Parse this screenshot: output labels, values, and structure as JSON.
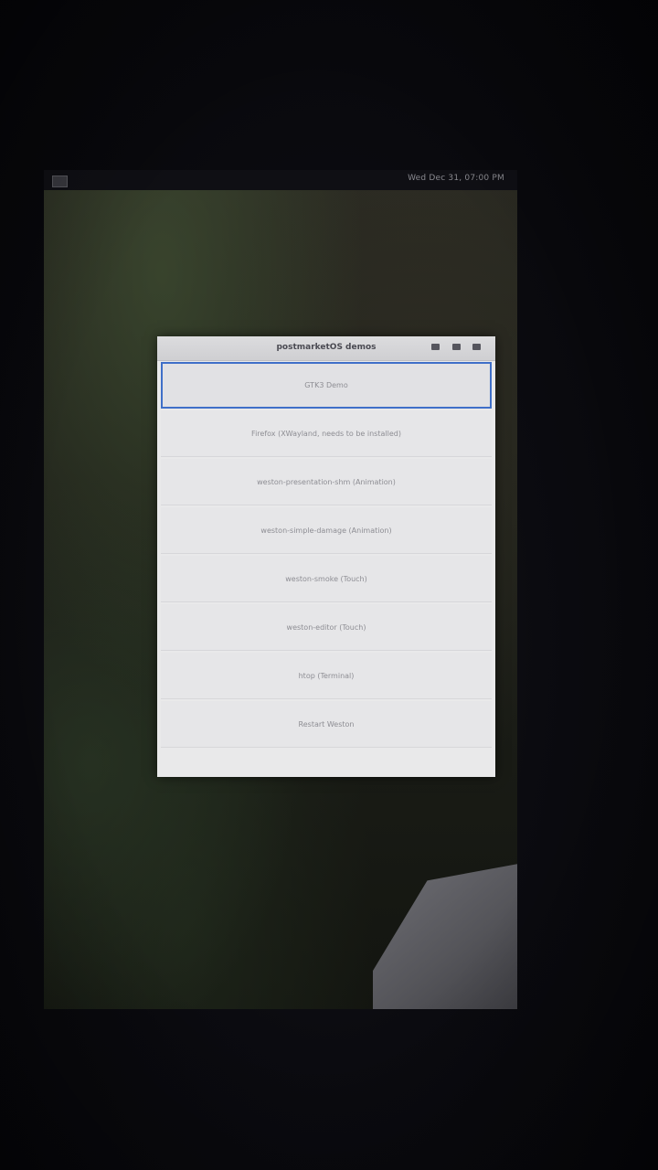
{
  "topbar": {
    "launcher_icon": "app-launcher-icon",
    "clock": "Wed Dec 31, 07:00 PM"
  },
  "window": {
    "title": "postmarketOS demos",
    "controls": [
      "minimize-icon",
      "maximize-icon",
      "close-icon"
    ],
    "items": [
      {
        "label": "GTK3 Demo",
        "selected": true
      },
      {
        "label": "Firefox (XWayland, needs to be installed)",
        "selected": false
      },
      {
        "label": "weston-presentation-shm (Animation)",
        "selected": false
      },
      {
        "label": "weston-simple-damage (Animation)",
        "selected": false
      },
      {
        "label": "weston-smoke (Touch)",
        "selected": false
      },
      {
        "label": "weston-editor (Touch)",
        "selected": false
      },
      {
        "label": "htop (Terminal)",
        "selected": false
      },
      {
        "label": "Restart Weston",
        "selected": false
      }
    ]
  },
  "colors": {
    "selection": "#3f6fc8",
    "window_bg": "#e9e9ea",
    "item_text": "#8d8d93"
  }
}
